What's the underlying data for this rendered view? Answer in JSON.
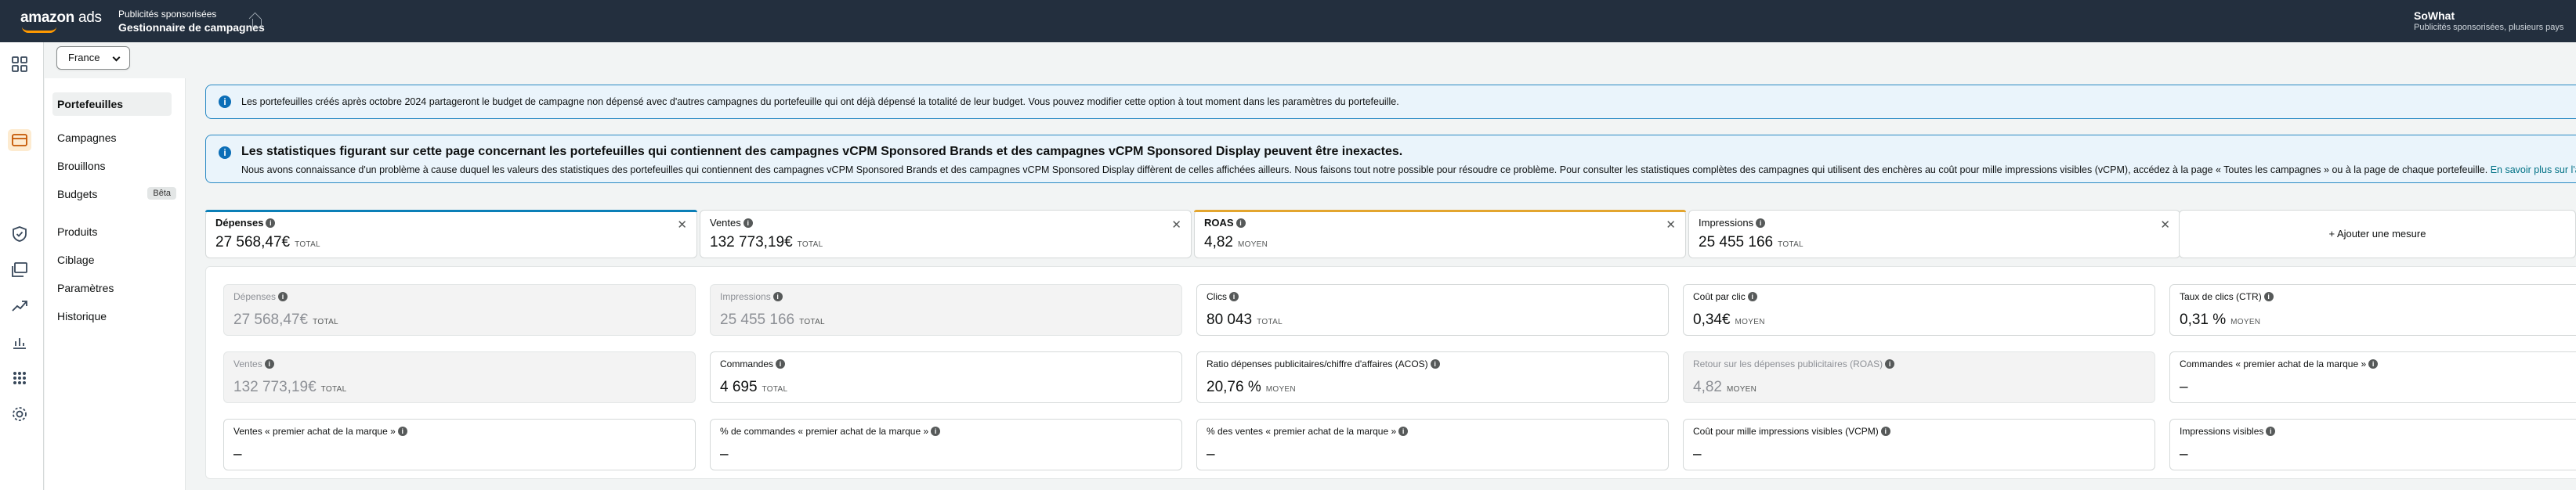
{
  "topbar": {
    "logo_text": "amazon",
    "logo_suffix": "ads",
    "subtitle": "Publicités sponsorisées",
    "title": "Gestionnaire de campagnes",
    "user_name": "SoWhat",
    "user_sub": "Publicités sponsorisées, plusieurs pays"
  },
  "country_selector": {
    "value": "France"
  },
  "subnav": [
    {
      "label": "Portefeuilles",
      "active": true
    },
    {
      "label": "Campagnes"
    },
    {
      "label": "Brouillons"
    },
    {
      "label": "Budgets",
      "badge": "Bêta"
    },
    {
      "label": "Produits"
    },
    {
      "label": "Ciblage"
    },
    {
      "label": "Paramètres"
    },
    {
      "label": "Historique"
    }
  ],
  "alerts": [
    {
      "text": "Les portefeuilles créés après octobre 2024 partageront le budget de campagne non dépensé avec d'autres campagnes du portefeuille qui ont déjà dépensé la totalité de leur budget. Vous pouvez modifier cette option à tout moment dans les paramètres du portefeuille."
    },
    {
      "title": "Les statistiques figurant sur cette page concernant les portefeuilles qui contiennent des campagnes vCPM Sponsored Brands et des campagnes vCPM Sponsored Display peuvent être inexactes.",
      "text": "Nous avons connaissance d'un problème à cause duquel les valeurs des statistiques des portefeuilles qui contiennent des campagnes vCPM Sponsored Brands et des campagnes vCPM Sponsored Display diffèrent de celles affichées ailleurs. Nous faisons tout notre possible pour résoudre ce problème. Pour consulter les statistiques complètes des campagnes qui utilisent des enchères au coût pour mille impressions visibles (vCPM), accédez à la page « Toutes les campagnes » ou à la page de chaque portefeuille.",
      "link": "En savoir plus sur l'attribution basée sur les vues"
    }
  ],
  "selected_metrics": [
    {
      "label": "Dépenses",
      "value": "27 568,47€",
      "unit": "TOTAL",
      "color": "#0b7fb7"
    },
    {
      "label": "Ventes",
      "value": "132 773,19€",
      "unit": "TOTAL",
      "color": ""
    },
    {
      "label": "ROAS",
      "value": "4,82",
      "unit": "MOYEN",
      "color": "#e3a52e"
    },
    {
      "label": "Impressions",
      "value": "25 455 166",
      "unit": "TOTAL",
      "color": ""
    }
  ],
  "add_metric_label": "+ Ajouter une mesure",
  "metric_cards": [
    {
      "label": "Dépenses",
      "value": "27 568,47€",
      "unit": "TOTAL",
      "disabled": true
    },
    {
      "label": "Impressions",
      "value": "25 455 166",
      "unit": "TOTAL",
      "disabled": true
    },
    {
      "label": "Clics",
      "value": "80 043",
      "unit": "TOTAL"
    },
    {
      "label": "Coût par clic",
      "value": "0,34€",
      "unit": "MOYEN"
    },
    {
      "label": "Taux de clics (CTR)",
      "value": "0,31 %",
      "unit": "MOYEN"
    },
    {
      "label": "Ventes",
      "value": "132 773,19€",
      "unit": "TOTAL",
      "disabled": true
    },
    {
      "label": "Commandes",
      "value": "4 695",
      "unit": "TOTAL"
    },
    {
      "label": "Ratio dépenses publicitaires/chiffre d'affaires (ACOS)",
      "value": "20,76 %",
      "unit": "MOYEN"
    },
    {
      "label": "Retour sur les dépenses publicitaires (ROAS)",
      "value": "4,82",
      "unit": "MOYEN",
      "disabled": true
    },
    {
      "label": "Commandes « premier achat de la marque »",
      "value": "–",
      "unit": ""
    },
    {
      "label": "Ventes « premier achat de la marque »",
      "value": "–",
      "unit": ""
    },
    {
      "label": "% de commandes « premier achat de la marque »",
      "value": "–",
      "unit": ""
    },
    {
      "label": "% des ventes « premier achat de la marque »",
      "value": "–",
      "unit": ""
    },
    {
      "label": "Coût pour mille impressions visibles (VCPM)",
      "value": "–",
      "unit": ""
    },
    {
      "label": "Impressions visibles",
      "value": "–",
      "unit": ""
    }
  ]
}
